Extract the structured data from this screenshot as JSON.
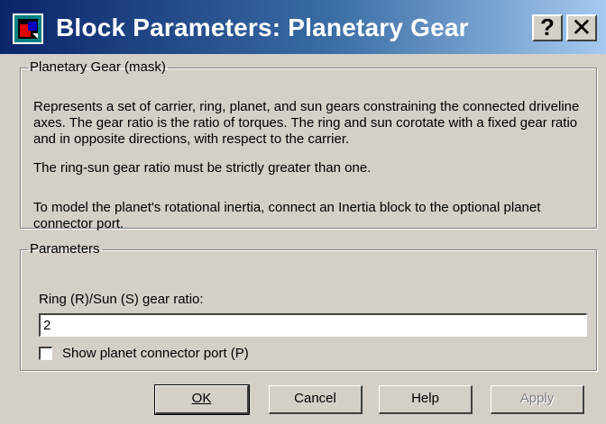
{
  "window": {
    "title": "Block Parameters: Planetary Gear",
    "help_glyph": "?",
    "close_glyph": "✕",
    "app_icon": "simulink-block-icon"
  },
  "description": {
    "legend": "Planetary Gear (mask)",
    "paragraphs": [
      "Represents a set of carrier, ring, planet, and sun gears constraining the connected driveline axes. The gear ratio is the ratio of torques. The ring and sun corotate with a fixed gear ratio and in opposite directions, with respect to the carrier.",
      "The ring-sun gear ratio must be strictly greater than one.",
      "To model the planet's rotational inertia, connect an Inertia block to the optional planet connector port."
    ]
  },
  "parameters": {
    "legend": "Parameters",
    "ratio_label": "Ring (R)/Sun (S) gear ratio:",
    "ratio_value": "2",
    "checkbox_label": "Show planet connector port (P)",
    "checkbox_checked": false
  },
  "buttons": {
    "ok": "OK",
    "cancel": "Cancel",
    "help": "Help",
    "apply": "Apply"
  },
  "colors": {
    "titlebar_start": "#0a246a",
    "titlebar_end": "#a6caf0",
    "dialog_bg": "#d4d0c8"
  }
}
